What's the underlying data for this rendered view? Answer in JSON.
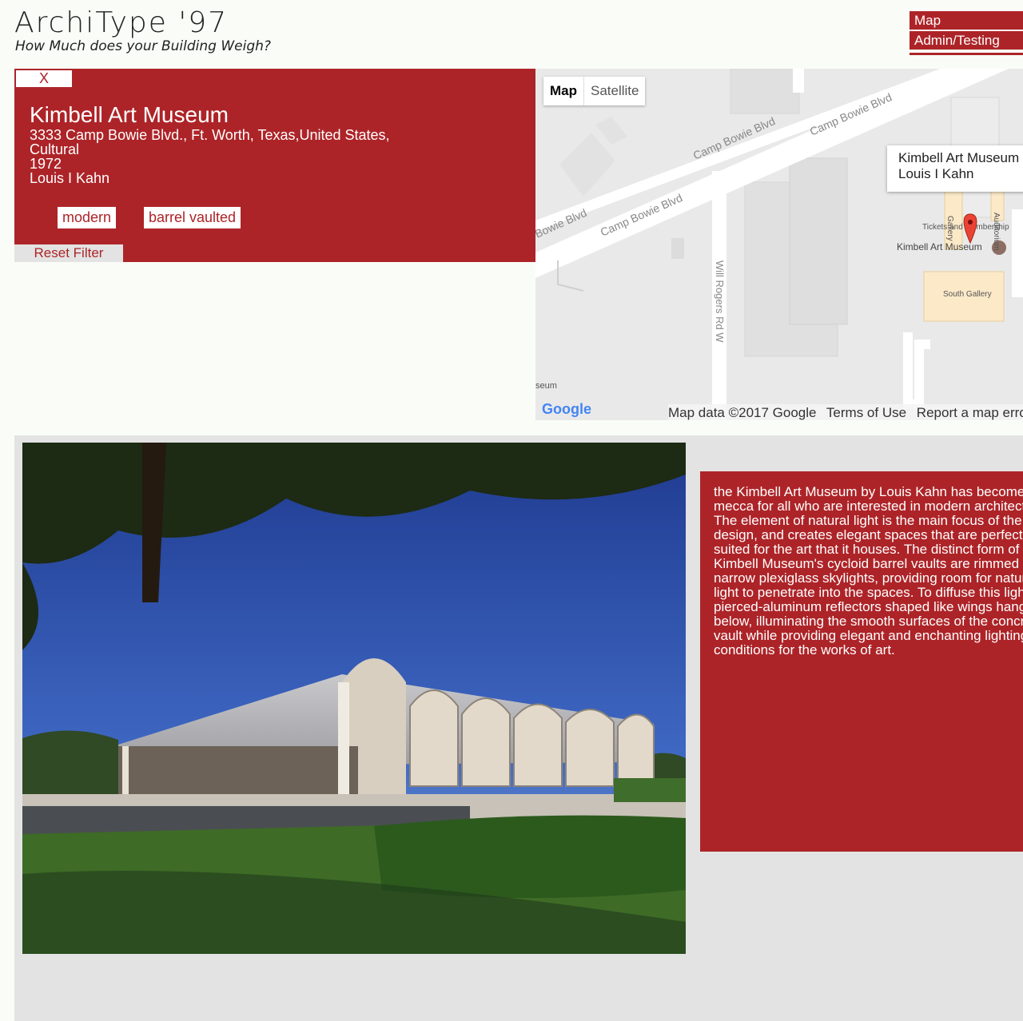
{
  "header": {
    "title": "ArchiType '97",
    "subtitle": "How Much does your Building Weigh?"
  },
  "nav": {
    "items": [
      "Map",
      "Admin/Testing"
    ]
  },
  "building": {
    "close_label": "X",
    "name": "Kimbell Art Museum",
    "address": "3333 Camp Bowie Blvd., Ft. Worth, Texas,United States,",
    "type": "Cultural",
    "year": "1972",
    "architect": "Louis I Kahn",
    "tags": [
      "modern",
      "barrel vaulted"
    ],
    "reset_label": "Reset Filter"
  },
  "map": {
    "type_map": "Map",
    "type_satellite": "Satellite",
    "infowindow": {
      "title": "Kimbell Art Museum",
      "subtitle": "Louis I Kahn"
    },
    "labels": {
      "road1": "Camp Bowie Blvd",
      "road2": "Camp Bowie Blvd",
      "road3": "Camp Bowie Blvd",
      "road4": "Bowie Blvd",
      "road5": "Will Rogers Rd W",
      "poi_museum": "Kimbell Art Museum",
      "poi_tickets": "Tickets and Membership",
      "poi_south": "South Gallery",
      "poi_gallery": "Gallery",
      "poi_auditorium": "Auditorium",
      "edge_text": "seum"
    },
    "footer": {
      "logo": "Google",
      "data": "Map data ©2017 Google",
      "terms": "Terms of Use",
      "report": "Report a map error"
    }
  },
  "description": "the Kimbell Art Museum by Louis Kahn has become a mecca for all who are interested in modern architecture. The element of natural light is the main focus of the design, and creates elegant spaces that are perfectly suited for the art that it houses. The distinct form of Kimbell Museum's cycloid barrel vaults are rimmed by narrow plexiglass skylights, providing room for natural light to penetrate into the spaces. To diffuse this light, pierced-aluminum reflectors shaped like wings hang below, illuminating the smooth surfaces of the concrete vault while providing elegant and enchanting lighting conditions for the works of art."
}
